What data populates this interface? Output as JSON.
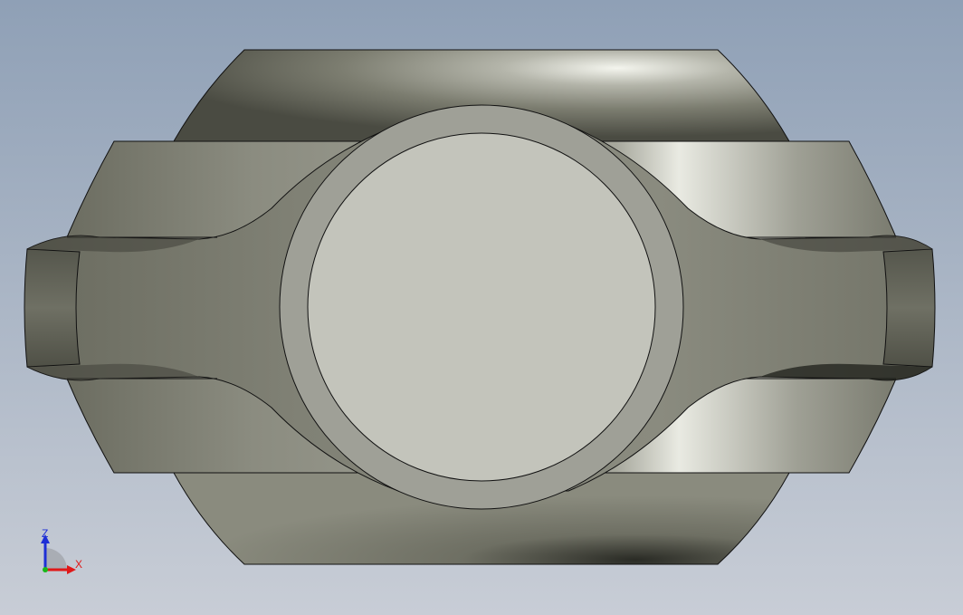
{
  "viewport": {
    "background_top": "#8fa0b6",
    "background_bottom": "#c8cdd6"
  },
  "model": {
    "body_color_dark": "#5d5e52",
    "body_color_mid": "#8a8b7e",
    "body_color_light": "#c9cac0",
    "highlight_color": "#f4f5ee",
    "face_color": "#c3c4bb",
    "ring_color": "#9fa097",
    "edge_color": "#111111"
  },
  "triad": {
    "z_label": "Z",
    "x_label": "X",
    "z_color": "#1e2fd6",
    "x_color": "#e01818",
    "y_color": "#18b818"
  }
}
